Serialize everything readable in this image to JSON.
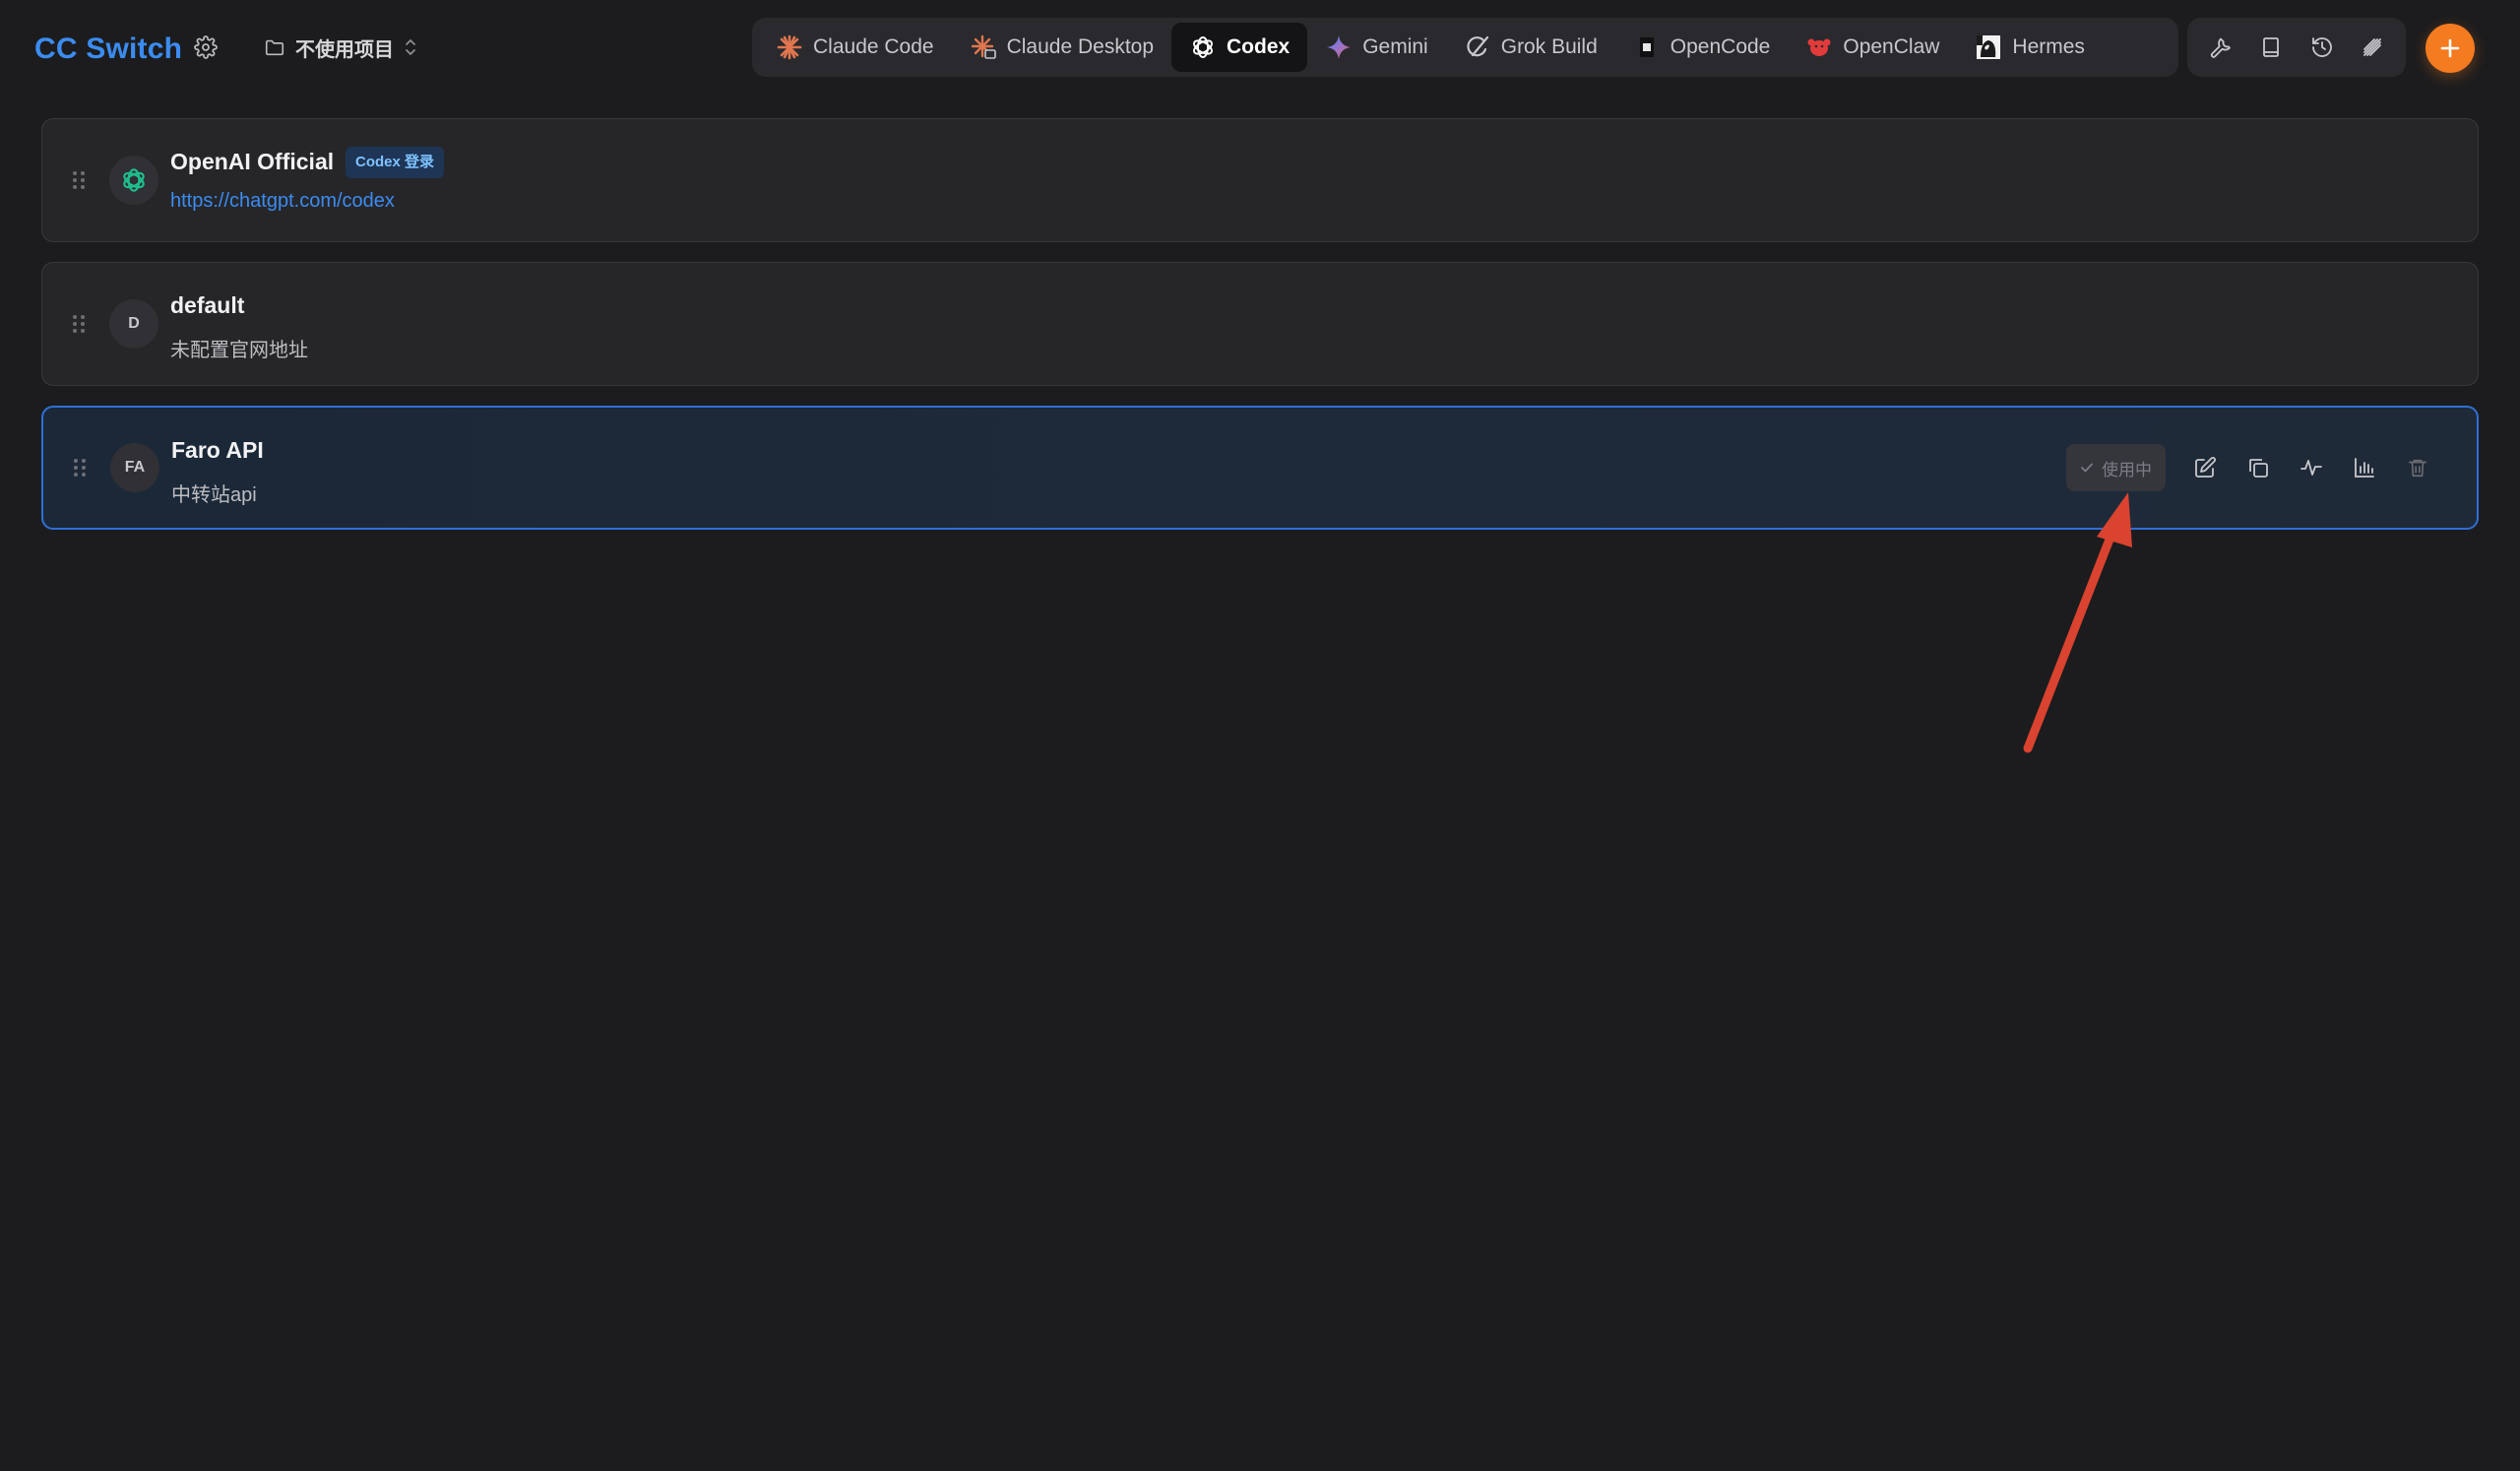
{
  "app": {
    "title": "CC Switch"
  },
  "header": {
    "project_label": "不使用项目",
    "tabs": [
      {
        "label": "Claude Code",
        "icon": "claude-code-icon",
        "active": false
      },
      {
        "label": "Claude Desktop",
        "icon": "claude-desktop-icon",
        "active": false
      },
      {
        "label": "Codex",
        "icon": "openai-icon",
        "active": true
      },
      {
        "label": "Gemini",
        "icon": "gemini-icon",
        "active": false
      },
      {
        "label": "Grok Build",
        "icon": "grok-icon",
        "active": false
      },
      {
        "label": "OpenCode",
        "icon": "opencode-icon",
        "active": false
      },
      {
        "label": "OpenClaw",
        "icon": "openclaw-icon",
        "active": false
      },
      {
        "label": "Hermes",
        "icon": "hermes-icon",
        "active": false
      }
    ],
    "tools": [
      "wrench-icon",
      "book-icon",
      "history-icon",
      "broadcast-icon"
    ],
    "colors": {
      "brand": "#3b8cf0",
      "accent": "#f47b20"
    }
  },
  "providers": [
    {
      "name": "OpenAI Official",
      "badge": "Codex 登录",
      "subtitle": "https://chatgpt.com/codex",
      "avatar": "openai-logo",
      "active": false
    },
    {
      "name": "default",
      "subtitle": "未配置官网地址",
      "avatar": "D",
      "active": false
    },
    {
      "name": "Faro API",
      "subtitle": "中转站api",
      "avatar": "FA",
      "active": true,
      "status": "使用中",
      "actions": [
        "edit-icon",
        "duplicate-icon",
        "test-icon",
        "stats-icon",
        "delete-icon"
      ]
    }
  ],
  "annotation": {
    "color": "#d9432f"
  }
}
